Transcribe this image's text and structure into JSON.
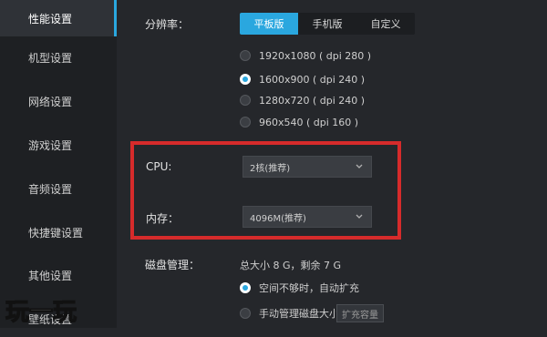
{
  "sidebar": {
    "items": [
      {
        "label": "性能设置",
        "active": true
      },
      {
        "label": "机型设置"
      },
      {
        "label": "网络设置"
      },
      {
        "label": "游戏设置"
      },
      {
        "label": "音频设置"
      },
      {
        "label": "快捷键设置"
      },
      {
        "label": "其他设置"
      },
      {
        "label": "壁纸设置"
      }
    ]
  },
  "resolution": {
    "label": "分辨率：",
    "tabs": [
      "平板版",
      "手机版",
      "自定义"
    ],
    "selected_tab": "平板版",
    "options": [
      {
        "text": "1920x1080 ( dpi 280 )",
        "checked": false
      },
      {
        "text": "1600x900 ( dpi 240 )",
        "checked": true
      },
      {
        "text": "1280x720 ( dpi 240 )",
        "checked": false
      },
      {
        "text": "960x540 ( dpi 160 )",
        "checked": false
      }
    ]
  },
  "cpu": {
    "label": "CPU:",
    "value": "2核(推荐)"
  },
  "memory": {
    "label": "内存：",
    "value": "4096M(推荐)"
  },
  "disk": {
    "label": "磁盘管理：",
    "info": "总大小 8 G，剩余 7 G",
    "option_auto": "空间不够时，自动扩充",
    "option_manual": "手动管理磁盘大小",
    "expand_button": "扩充容量",
    "selected": "auto"
  },
  "watermark": {
    "text": "玩一玩"
  },
  "colors": {
    "accent": "#2aa7df",
    "highlight_box": "#d62b2b",
    "background": "#25272b",
    "sidebar": "#1e2023"
  }
}
